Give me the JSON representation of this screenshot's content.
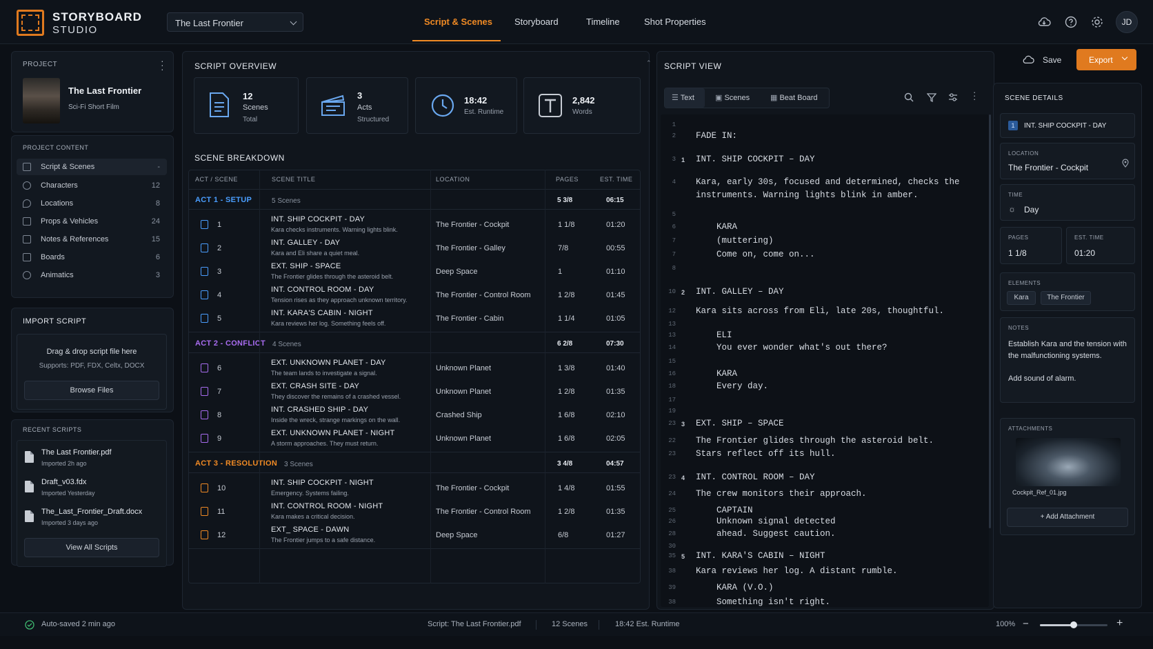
{
  "app": {
    "name_line1": "STORYBOARD",
    "name_line2": "STUDIO",
    "project_select": "The Last Frontier",
    "avatar": "JD"
  },
  "nav": {
    "tabs": [
      "Script & Scenes",
      "Storyboard",
      "Timeline",
      "Shot Properties"
    ],
    "active": "Script & Scenes"
  },
  "project": {
    "section": "PROJECT",
    "title": "The Last Frontier",
    "subtitle": "Sci-Fi Short Film"
  },
  "content": {
    "section": "PROJECT CONTENT",
    "items": [
      {
        "label": "Script & Scenes",
        "count": "-",
        "icon": "script-icon"
      },
      {
        "label": "Characters",
        "count": "12",
        "icon": "characters-icon"
      },
      {
        "label": "Locations",
        "count": "8",
        "icon": "locations-icon"
      },
      {
        "label": "Props & Vehicles",
        "count": "24",
        "icon": "props-icon"
      },
      {
        "label": "Notes & References",
        "count": "15",
        "icon": "notes-icon"
      },
      {
        "label": "Boards",
        "count": "6",
        "icon": "boards-icon"
      },
      {
        "label": "Animatics",
        "count": "3",
        "icon": "animatics-icon"
      }
    ]
  },
  "import": {
    "section": "IMPORT SCRIPT",
    "drop_text": "Drag & drop script file here",
    "supports": "Supports: PDF, FDX, Celtx, DOCX",
    "browse": "Browse Files"
  },
  "recent": {
    "section": "RECENT SCRIPTS",
    "items": [
      {
        "name": "The Last Frontier.pdf",
        "sub": "Imported 2h ago"
      },
      {
        "name": "Draft_v03.fdx",
        "sub": "Imported Yesterday"
      },
      {
        "name": "The_Last_Frontier_Draft.docx",
        "sub": "Imported 3 days ago"
      }
    ],
    "view_all": "View All Scripts"
  },
  "overview": {
    "title": "SCRIPT OVERVIEW",
    "stats": [
      {
        "value": "12",
        "label": "Scenes",
        "sub": "Total",
        "icon": "document-icon"
      },
      {
        "value": "3",
        "label": "Acts",
        "sub": "Structured",
        "icon": "clapperboard-icon"
      },
      {
        "value": "18:42",
        "label": "Est. Runtime",
        "sub": "",
        "icon": "clock-icon"
      },
      {
        "value": "2,842",
        "label": "Words",
        "sub": "",
        "icon": "text-icon"
      }
    ]
  },
  "breakdown": {
    "title": "SCENE BREAKDOWN",
    "headers": [
      "ACT / SCENE",
      "SCENE TITLE",
      "LOCATION",
      "PAGES",
      "EST. TIME"
    ],
    "acts": [
      {
        "name": "ACT 1 - SETUP",
        "count": "5 Scenes",
        "pages": "5 3/8",
        "time": "06:15",
        "color": "#4a9eff",
        "scenes": [
          {
            "num": "1",
            "title": "INT. SHIP COCKPIT - DAY",
            "desc": "Kara checks instruments. Warning lights blink.",
            "loc": "The Frontier - Cockpit",
            "pages": "1 1/8",
            "time": "01:20"
          },
          {
            "num": "2",
            "title": "INT. GALLEY - DAY",
            "desc": "Kara and Eli share a quiet meal.",
            "loc": "The Frontier - Galley",
            "pages": "7/8",
            "time": "00:55"
          },
          {
            "num": "3",
            "title": "EXT. SHIP - SPACE",
            "desc": "The Frontier glides through the asteroid belt.",
            "loc": "Deep Space",
            "pages": "1",
            "time": "01:10"
          },
          {
            "num": "4",
            "title": "INT. CONTROL ROOM - DAY",
            "desc": "Tension rises as they approach unknown territory.",
            "loc": "The Frontier - Control Room",
            "pages": "1 2/8",
            "time": "01:45"
          },
          {
            "num": "5",
            "title": "INT. KARA'S CABIN - NIGHT",
            "desc": "Kara reviews her log. Something feels off.",
            "loc": "The Frontier - Cabin",
            "pages": "1 1/4",
            "time": "01:05"
          }
        ]
      },
      {
        "name": "ACT 2 - CONFLICT",
        "count": "4 Scenes",
        "pages": "6 2/8",
        "time": "07:30",
        "color": "#a86cf0",
        "scenes": [
          {
            "num": "6",
            "title": "EXT. UNKNOWN PLANET - DAY",
            "desc": "The team lands to investigate a signal.",
            "loc": "Unknown Planet",
            "pages": "1 3/8",
            "time": "01:40"
          },
          {
            "num": "7",
            "title": "EXT. CRASH SITE - DAY",
            "desc": "They discover the remains of a crashed vessel.",
            "loc": "Unknown Planet",
            "pages": "1 2/8",
            "time": "01:35"
          },
          {
            "num": "8",
            "title": "INT. CRASHED SHIP - DAY",
            "desc": "Inside the wreck, strange markings on the wall.",
            "loc": "Crashed Ship",
            "pages": "1 6/8",
            "time": "02:10"
          },
          {
            "num": "9",
            "title": "EXT. UNKNOWN PLANET - NIGHT",
            "desc": "A storm approaches. They must return.",
            "loc": "Unknown Planet",
            "pages": "1 6/8",
            "time": "02:05"
          }
        ]
      },
      {
        "name": "ACT 3 - RESOLUTION",
        "count": "3 Scenes",
        "pages": "3 4/8",
        "time": "04:57",
        "color": "#f08a24",
        "scenes": [
          {
            "num": "10",
            "title": "INT. SHIP COCKPIT - NIGHT",
            "desc": "Emergency. Systems failing.",
            "loc": "The Frontier - Cockpit",
            "pages": "1 4/8",
            "time": "01:55"
          },
          {
            "num": "11",
            "title": "INT. CONTROL ROOM - NIGHT",
            "desc": "Kara makes a critical decision.",
            "loc": "The Frontier - Control Room",
            "pages": "1 2/8",
            "time": "01:35"
          },
          {
            "num": "12",
            "title": "EXT_ SPACE - DAWN",
            "desc": "The Frontier jumps to a safe distance.",
            "loc": "Deep Space",
            "pages": "6/8",
            "time": "01:27"
          }
        ]
      }
    ]
  },
  "script_view": {
    "title": "SCRIPT VIEW",
    "tabs": [
      "Text",
      "Scenes",
      "Beat Board"
    ],
    "lines": [
      {
        "n": "1",
        "s": "",
        "t": ""
      },
      {
        "n": "2",
        "s": "",
        "t": "FADE IN:"
      },
      {
        "n": "3",
        "s": "1",
        "t": "INT. SHIP COCKPIT – DAY"
      },
      {
        "n": "4",
        "s": "",
        "t": "Kara, early 30s, focused and determined, checks the"
      },
      {
        "n": "",
        "s": "",
        "t": "instruments. Warning lights blink in amber."
      },
      {
        "n": "5",
        "s": "",
        "t": ""
      },
      {
        "n": "6",
        "s": "",
        "t": "    KARA"
      },
      {
        "n": "7",
        "s": "",
        "t": "    (muttering)"
      },
      {
        "n": "7",
        "s": "",
        "t": "    Come on, come on..."
      },
      {
        "n": "8",
        "s": "",
        "t": ""
      },
      {
        "n": "10",
        "s": "2",
        "t": "INT. GALLEY – DAY"
      },
      {
        "n": "12",
        "s": "",
        "t": "Kara sits across from Eli, late 20s, thoughtful."
      },
      {
        "n": "13",
        "s": "",
        "t": ""
      },
      {
        "n": "13",
        "s": "",
        "t": "    ELI"
      },
      {
        "n": "14",
        "s": "",
        "t": "    You ever wonder what's out there?"
      },
      {
        "n": "15",
        "s": "",
        "t": ""
      },
      {
        "n": "16",
        "s": "",
        "t": "    KARA"
      },
      {
        "n": "18",
        "s": "",
        "t": "    Every day."
      },
      {
        "n": "17",
        "s": "",
        "t": ""
      },
      {
        "n": "19",
        "s": "",
        "t": ""
      },
      {
        "n": "23",
        "s": "3",
        "t": "EXT. SHIP – SPACE"
      },
      {
        "n": "22",
        "s": "",
        "t": "The Frontier glides through the asteroid belt."
      },
      {
        "n": "23",
        "s": "",
        "t": "Stars reflect off its hull."
      },
      {
        "n": "23",
        "s": "4",
        "t": "INT. CONTROL ROOM – DAY"
      },
      {
        "n": "24",
        "s": "",
        "t": "The crew monitors their approach."
      },
      {
        "n": "25",
        "s": "",
        "t": "    CAPTAIN"
      },
      {
        "n": "26",
        "s": "",
        "t": "    Unknown signal detected"
      },
      {
        "n": "28",
        "s": "",
        "t": "    ahead. Suggest caution."
      },
      {
        "n": "30",
        "s": "",
        "t": ""
      },
      {
        "n": "35",
        "s": "5",
        "t": "INT. KARA'S CABIN – NIGHT"
      },
      {
        "n": "38",
        "s": "",
        "t": "Kara reviews her log. A distant rumble."
      },
      {
        "n": "39",
        "s": "",
        "t": "    KARA (V.O.)"
      },
      {
        "n": "38",
        "s": "",
        "t": "    Something isn't right."
      }
    ]
  },
  "actions": {
    "save": "Save",
    "export": "Export"
  },
  "details": {
    "title": "SCENE DETAILS",
    "scene_num": "1",
    "scene_heading": "INT. SHIP COCKPIT - DAY",
    "location_label": "LOCATION",
    "location": "The Frontier - Cockpit",
    "time_label": "TIME",
    "time": "Day",
    "pages_label": "PAGES",
    "pages": "1 1/8",
    "est_label": "EST. TIME",
    "est": "01:20",
    "elements_label": "ELEMENTS",
    "elements": [
      "Kara",
      "The Frontier"
    ],
    "notes_label": "NOTES",
    "notes_1": "Establish Kara and the tension with the malfunctioning systems.",
    "notes_2": "Add sound of alarm.",
    "attachments_label": "ATTACHMENTS",
    "attachment_name": "Cockpit_Ref_01.jpg",
    "add_attachment": "Add Attachment"
  },
  "status": {
    "autosave": "Auto-saved 2 min ago",
    "script": "Script: The Last Frontier.pdf",
    "scenes": "12 Scenes",
    "runtime": "18:42 Est. Runtime",
    "zoom": "100%",
    "zoom_level": 0.5
  }
}
